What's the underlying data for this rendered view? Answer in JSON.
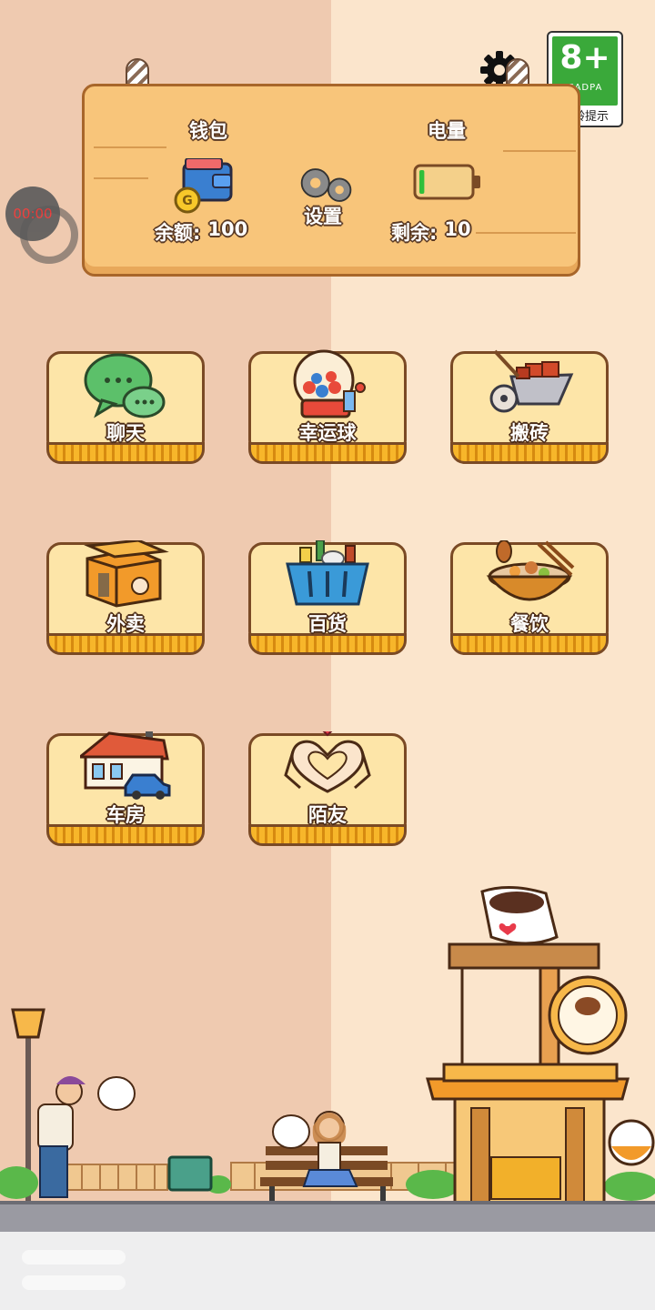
{
  "rating": {
    "age": "8+",
    "org": "CADPA",
    "tip": "适龄提示"
  },
  "wallet": {
    "title": "钱包",
    "balance_label": "余额:",
    "balance_value": "100"
  },
  "settings": {
    "label": "设置"
  },
  "battery": {
    "title": "电量",
    "remaining_label": "剩余:",
    "remaining_value": "10",
    "level": 0.1
  },
  "recorder": {
    "time": "00:00"
  },
  "apps": [
    {
      "label": "聊天",
      "icon": "chat-bubbles-icon"
    },
    {
      "label": "幸运球",
      "icon": "lucky-ball-machine-icon"
    },
    {
      "label": "搬砖",
      "icon": "wheelbarrow-bricks-icon"
    },
    {
      "label": "外卖",
      "icon": "delivery-box-icon"
    },
    {
      "label": "百货",
      "icon": "shopping-basket-icon"
    },
    {
      "label": "餐饮",
      "icon": "food-bowl-icon"
    },
    {
      "label": "车房",
      "icon": "house-car-icon"
    },
    {
      "label": "陌友",
      "icon": "heart-hands-icon"
    }
  ],
  "colors": {
    "accent": "#f7b62a",
    "card": "#fde5a8",
    "outline": "#7a4a25",
    "battery": "#2fbf3a"
  }
}
